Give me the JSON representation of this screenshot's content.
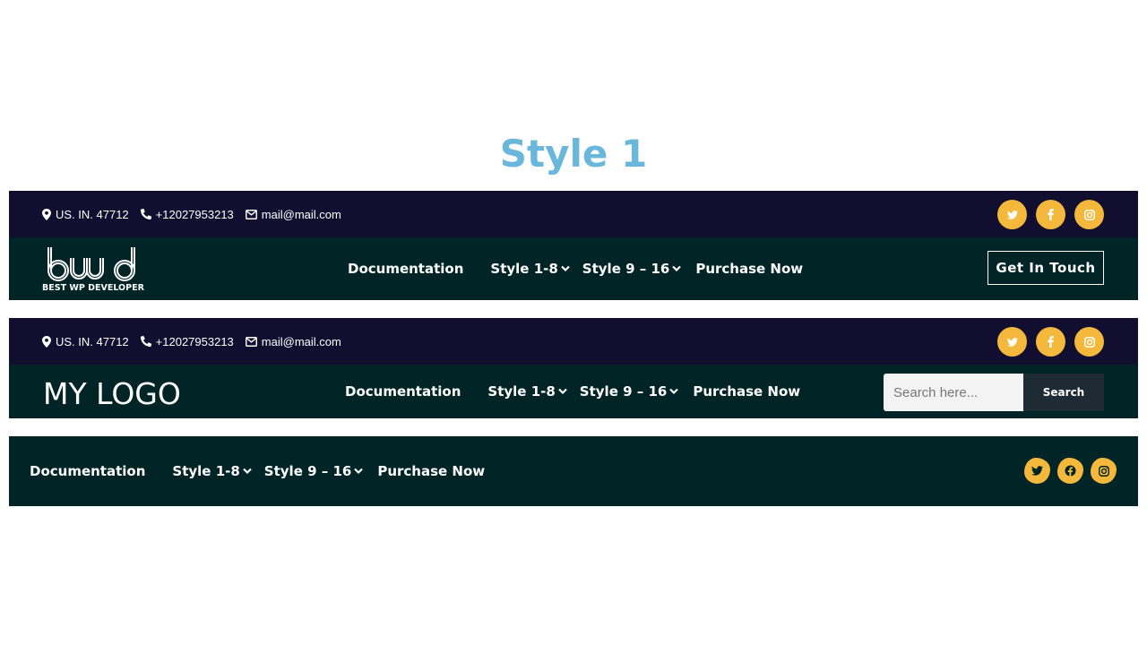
{
  "page_title": "Style 1",
  "header1": {
    "contacts": [
      {
        "icon": "map-pin-icon",
        "text": "US. IN. 47712"
      },
      {
        "icon": "phone-icon",
        "text": "+12027953213"
      },
      {
        "icon": "envelope-icon",
        "text": "mail@mail.com"
      }
    ],
    "socials": [
      "twitter-icon",
      "facebook-icon",
      "instagram-icon"
    ],
    "logo": {
      "mark": "bwd",
      "tagline": "BEST WP DEVELOPER"
    },
    "nav": [
      {
        "label": "Documentation",
        "dropdown": false
      },
      {
        "label": "Style 1-8",
        "dropdown": true
      },
      {
        "label": "Style 9 – 16",
        "dropdown": true
      },
      {
        "label": "Purchase Now",
        "dropdown": false
      }
    ],
    "cta_label": "Get In Touch"
  },
  "header2": {
    "contacts": [
      {
        "icon": "map-pin-icon",
        "text": "US. IN. 47712"
      },
      {
        "icon": "phone-icon",
        "text": "+12027953213"
      },
      {
        "icon": "envelope-icon",
        "text": "mail@mail.com"
      }
    ],
    "socials": [
      "twitter-icon",
      "facebook-icon",
      "instagram-icon"
    ],
    "logo_text": "MY LOGO",
    "nav": [
      {
        "label": "Documentation",
        "dropdown": false
      },
      {
        "label": "Style 1-8",
        "dropdown": true
      },
      {
        "label": "Style 9 – 16",
        "dropdown": true
      },
      {
        "label": "Purchase Now",
        "dropdown": false
      }
    ],
    "search": {
      "placeholder": "Search here...",
      "button_label": "Search"
    }
  },
  "header3": {
    "nav": [
      {
        "label": "Documentation",
        "dropdown": false
      },
      {
        "label": "Style 1-8",
        "dropdown": true
      },
      {
        "label": "Style 9 – 16",
        "dropdown": true
      },
      {
        "label": "Purchase Now",
        "dropdown": false
      }
    ],
    "socials": [
      "twitter-icon",
      "facebook-icon",
      "instagram-icon"
    ]
  },
  "colors": {
    "title": "#6ab7dc",
    "topbar_bg": "#110e30",
    "mainbar_bg": "#012527",
    "accent": "#f4b93c",
    "search_button_bg": "#1e2b35"
  }
}
